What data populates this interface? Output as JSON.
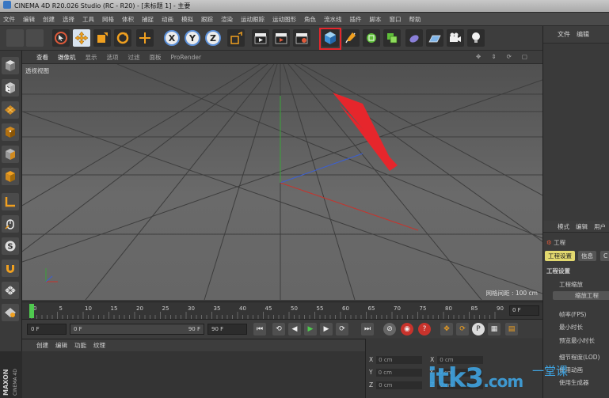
{
  "window": {
    "title": "CINEMA 4D R20.026 Studio (RC - R20) - [未标题 1] - 主要"
  },
  "menu": [
    "文件",
    "编辑",
    "创建",
    "选择",
    "工具",
    "网格",
    "体积",
    "捕捉",
    "动画",
    "模拟",
    "跟踪",
    "渲染",
    "运动跟踪",
    "运动图形",
    "角色",
    "流水线",
    "插件",
    "脚本",
    "窗口",
    "帮助"
  ],
  "toolbar": {
    "axis_x": "X",
    "axis_y": "Y",
    "axis_z": "Z",
    "highlight_color": "#e6262c",
    "icons": [
      "undo-icon",
      "redo-icon",
      "live-select-icon",
      "move-icon",
      "scale-icon",
      "rotate-icon",
      "add-icon",
      "axis-x",
      "axis-y",
      "axis-z",
      "coordinate-system-icon",
      "render-view-icon",
      "render-picture-viewer-icon",
      "render-settings-icon",
      "cube-icon",
      "pen-spline-icon",
      "subdivision-icon",
      "array-icon",
      "deformer-icon",
      "floor-icon",
      "camera-icon",
      "light-icon"
    ]
  },
  "right_top": {
    "file": "文件",
    "edit": "编辑"
  },
  "viewport": {
    "menus": [
      "查看",
      "摄像机",
      "显示",
      "选项",
      "过滤",
      "面板",
      "ProRender"
    ],
    "label": "透视视图",
    "grid_scale": "网格间距 : 100 cm"
  },
  "timeline": {
    "ticks": [
      "0",
      "5",
      "10",
      "15",
      "20",
      "25",
      "30",
      "35",
      "40",
      "45",
      "50",
      "55",
      "60",
      "65",
      "70",
      "75",
      "80",
      "85",
      "90"
    ],
    "end_frame": "0 F"
  },
  "playback": {
    "start": "0 F",
    "current": "0 F",
    "range_end": "90 F",
    "max": "90 F"
  },
  "material": {
    "menus": [
      "创建",
      "编辑",
      "功能",
      "纹理"
    ]
  },
  "coords": {
    "x": "X",
    "y": "Y",
    "z": "Z",
    "xv": "0 cm",
    "yv": "0 cm",
    "zv": "0 cm",
    "x2": "X",
    "y2": "Y",
    "z2": "Z",
    "x2v": "0 cm",
    "y2v": "0 cm",
    "z2v": "0 cm"
  },
  "attributes": {
    "menus": [
      "模式",
      "编辑",
      "用户"
    ],
    "object": "工程",
    "tab_settings": "工程设置",
    "tab_info": "信息",
    "tab_other": "C",
    "section": "工程设置",
    "scale_label": "工程缩放",
    "scale_button": "缩放工程",
    "fps": "帧率(FPS)",
    "min_time": "最小时长",
    "preview_min": "预览最小时长",
    "lod": "细节程度(LOD)",
    "use_anim": "使用动画",
    "use_gen": "使用生成器"
  },
  "brand": {
    "maxon": "MAXON",
    "c4d": "CINEMA 4D"
  },
  "watermark": {
    "text": "itk3",
    "sub": "一堂课",
    "domain": ".com"
  }
}
